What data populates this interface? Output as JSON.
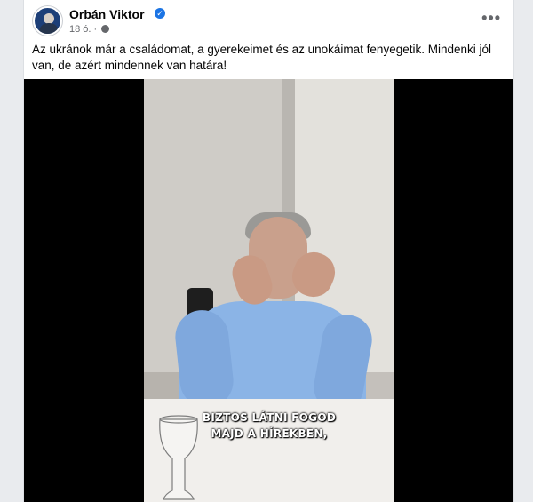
{
  "post": {
    "author": "Orbán Viktor",
    "time": "18 ó. ·",
    "more_label": "•••",
    "text": "Az ukránok már a családomat, a gyerekeimet és az unokáimat fenyegetik. Mindenki jól van, de azért mindennek van határa!"
  },
  "video": {
    "caption_line1": "BIZTOS LÁTNI FOGOD",
    "caption_line2": "MAJD A HÍREKBEN,"
  },
  "icons": {
    "verified": "verified-badge-icon",
    "audience": "globe-icon",
    "more": "more-options-icon"
  },
  "colors": {
    "verified_blue": "#1b74e4",
    "text_primary": "#050505",
    "text_secondary": "#65676b"
  }
}
